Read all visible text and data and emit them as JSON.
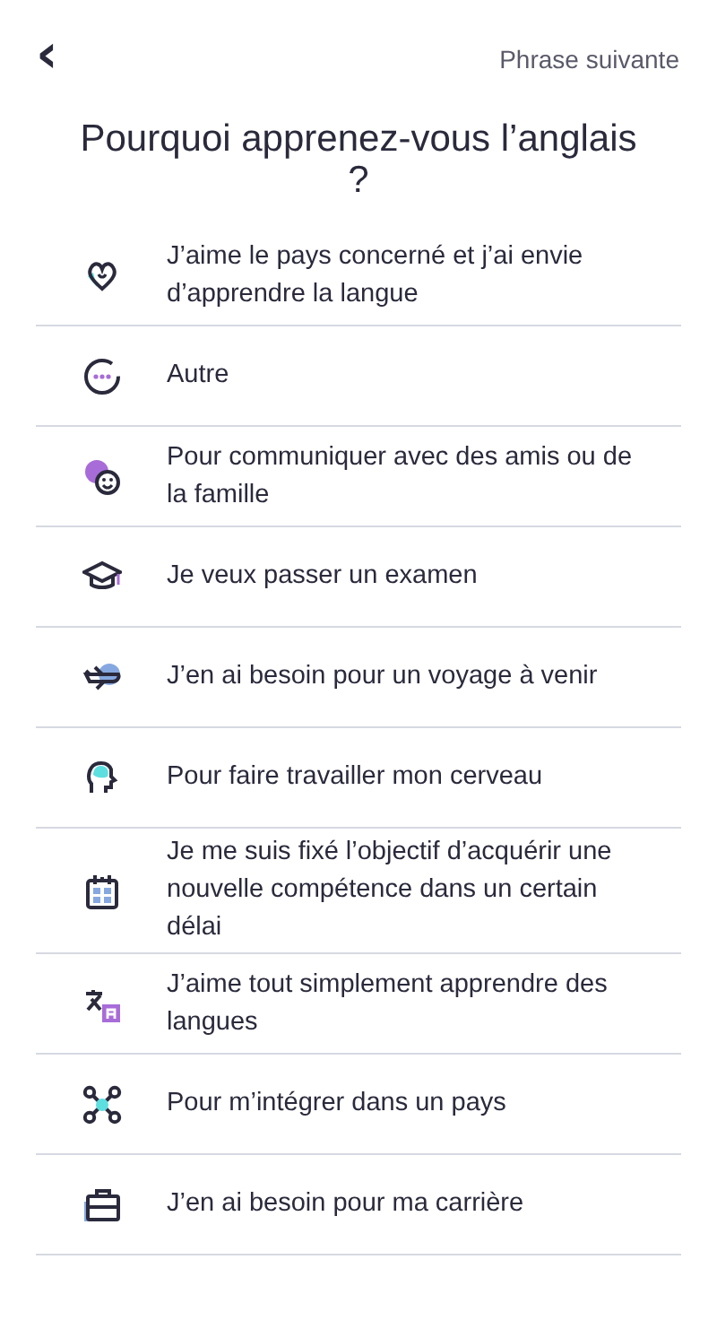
{
  "header": {
    "back": "‹",
    "next_link": "Phrase suivante"
  },
  "title": "Pourquoi apprenez-vous l’anglais ?",
  "options": [
    {
      "kind": "heart",
      "label": "J’aime le pays concerné et j’ai envie d’apprendre la langue"
    },
    {
      "kind": "dots",
      "label": "Autre"
    },
    {
      "kind": "faces",
      "label": "Pour communiquer avec des amis ou de la famille"
    },
    {
      "kind": "cap",
      "label": "Je veux passer un examen"
    },
    {
      "kind": "plane",
      "label": "J’en ai besoin pour un voyage à venir"
    },
    {
      "kind": "head",
      "label": "Pour faire travailler mon cerveau"
    },
    {
      "kind": "calendar",
      "label": "Je me suis fixé l’objectif d’acquérir une nouvelle compétence dans un certain délai"
    },
    {
      "kind": "translate",
      "label": "J’aime tout simplement apprendre des langues"
    },
    {
      "kind": "network",
      "label": "Pour m’intégrer dans un pays"
    },
    {
      "kind": "briefcase",
      "label": "J’en ai besoin pour ma carrière"
    }
  ]
}
